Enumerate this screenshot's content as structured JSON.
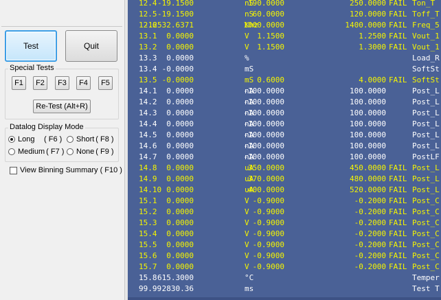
{
  "colors": {
    "pass": "#ffffff",
    "fail": "#f5f500",
    "background": "#4a6196"
  },
  "buttons": {
    "test": "Test",
    "quit": "Quit",
    "retest": "Re-Test  (Alt+R)"
  },
  "special_tests": {
    "title": "Special Tests",
    "keys": [
      "F1",
      "F2",
      "F3",
      "F4",
      "F5"
    ]
  },
  "datalog": {
    "title": "Datalog Display Mode",
    "options": [
      {
        "label": "Long",
        "key": "( F6 )",
        "selected": true
      },
      {
        "label": "Short",
        "key": "( F8 )",
        "selected": false
      },
      {
        "label": "Medium",
        "key": "( F7 )",
        "selected": false
      },
      {
        "label": "None",
        "key": "( F9 )",
        "selected": false
      }
    ]
  },
  "binning": {
    "label": "View Binning Summary ( F10 )",
    "checked": false
  },
  "log_rows": [
    {
      "test": "12.4",
      "value": "-19.1500",
      "unit": "nS",
      "lo": "190.0000",
      "hi": "250.0000",
      "pf": "FAIL",
      "name": "Ton_T",
      "fail": true
    },
    {
      "test": "12.5",
      "value": "-19.1500",
      "unit": "nS",
      "lo": "60.0000",
      "hi": "120.0000",
      "pf": "FAIL",
      "name": "Toff_T",
      "fail": true
    },
    {
      "test": "12.6",
      "value": "-12532.6371",
      "unit": "Khz",
      "lo": "1000.0000",
      "hi": "1400.0000",
      "pf": "FAIL",
      "name": "Freq_5",
      "fail": true
    },
    {
      "test": "13.1",
      "value": "0.0000",
      "unit": "V",
      "lo": "1.1500",
      "hi": "1.2500",
      "pf": "FAIL",
      "name": "Vout_1",
      "fail": true
    },
    {
      "test": "13.2",
      "value": "0.0000",
      "unit": "V",
      "lo": "1.1500",
      "hi": "1.3000",
      "pf": "FAIL",
      "name": "Vout_1",
      "fail": true
    },
    {
      "test": "13.3",
      "value": "0.0000",
      "unit": "%",
      "lo": "",
      "hi": "",
      "pf": "",
      "name": "Load_R",
      "fail": false
    },
    {
      "test": "13.4",
      "value": "-0.0000",
      "unit": "mS",
      "lo": "",
      "hi": "",
      "pf": "",
      "name": "SoftSt",
      "fail": false
    },
    {
      "test": "13.5",
      "value": "-0.0000",
      "unit": "mS",
      "lo": "0.6000",
      "hi": "4.0000",
      "pf": "FAIL",
      "name": "SoftSt",
      "fail": true
    },
    {
      "test": "14.1",
      "value": "0.0000",
      "unit": "nA",
      "lo": "-100.0000",
      "hi": "100.0000",
      "pf": "",
      "name": "Post_L",
      "fail": false
    },
    {
      "test": "14.2",
      "value": "0.0000",
      "unit": "nA",
      "lo": "-100.0000",
      "hi": "100.0000",
      "pf": "",
      "name": "Post_L",
      "fail": false
    },
    {
      "test": "14.3",
      "value": "0.0000",
      "unit": "nA",
      "lo": "-100.0000",
      "hi": "100.0000",
      "pf": "",
      "name": "Post_L",
      "fail": false
    },
    {
      "test": "14.4",
      "value": "0.0000",
      "unit": "nA",
      "lo": "-100.0000",
      "hi": "100.0000",
      "pf": "",
      "name": "Post_L",
      "fail": false
    },
    {
      "test": "14.5",
      "value": "0.0000",
      "unit": "nA",
      "lo": "-100.0000",
      "hi": "100.0000",
      "pf": "",
      "name": "Post_L",
      "fail": false
    },
    {
      "test": "14.6",
      "value": "0.0000",
      "unit": "nA",
      "lo": "-100.0000",
      "hi": "100.0000",
      "pf": "",
      "name": "Post_L",
      "fail": false
    },
    {
      "test": "14.7",
      "value": "0.0000",
      "unit": "nA",
      "lo": "-100.0000",
      "hi": "100.0000",
      "pf": "",
      "name": "PostLF",
      "fail": false
    },
    {
      "test": "14.8",
      "value": "0.0000",
      "unit": "uA",
      "lo": "350.0000",
      "hi": "450.0000",
      "pf": "FAIL",
      "name": "Post_L",
      "fail": true
    },
    {
      "test": "14.9",
      "value": "0.0000",
      "unit": "uA",
      "lo": "370.0000",
      "hi": "480.0000",
      "pf": "FAIL",
      "name": "Post_L",
      "fail": true
    },
    {
      "test": "14.10",
      "value": "0.0000",
      "unit": "uA",
      "lo": "400.0000",
      "hi": "520.0000",
      "pf": "FAIL",
      "name": "Post_L",
      "fail": true
    },
    {
      "test": "15.1",
      "value": "0.0000",
      "unit": "V",
      "lo": "-0.9000",
      "hi": "-0.2000",
      "pf": "FAIL",
      "name": "Post_C",
      "fail": true
    },
    {
      "test": "15.2",
      "value": "0.0000",
      "unit": "V",
      "lo": "-0.9000",
      "hi": "-0.2000",
      "pf": "FAIL",
      "name": "Post_C",
      "fail": true
    },
    {
      "test": "15.3",
      "value": "0.0000",
      "unit": "V",
      "lo": "-0.9000",
      "hi": "-0.2000",
      "pf": "FAIL",
      "name": "Post_C",
      "fail": true
    },
    {
      "test": "15.4",
      "value": "0.0000",
      "unit": "V",
      "lo": "-0.9000",
      "hi": "-0.2000",
      "pf": "FAIL",
      "name": "Post_C",
      "fail": true
    },
    {
      "test": "15.5",
      "value": "0.0000",
      "unit": "V",
      "lo": "-0.9000",
      "hi": "-0.2000",
      "pf": "FAIL",
      "name": "Post_C",
      "fail": true
    },
    {
      "test": "15.6",
      "value": "0.0000",
      "unit": "V",
      "lo": "-0.9000",
      "hi": "-0.2000",
      "pf": "FAIL",
      "name": "Post_C",
      "fail": true
    },
    {
      "test": "15.7",
      "value": "0.0000",
      "unit": "V",
      "lo": "-0.9000",
      "hi": "-0.2000",
      "pf": "FAIL",
      "name": "Post_C",
      "fail": true
    },
    {
      "test": "15.8",
      "value": "615.3000",
      "unit": "°C",
      "lo": "",
      "hi": "",
      "pf": "",
      "name": "Temper",
      "fail": false
    },
    {
      "test": "99.99",
      "value": "2830.36",
      "unit": "ms",
      "lo": "",
      "hi": "",
      "pf": "",
      "name": "Test T",
      "fail": false
    }
  ]
}
